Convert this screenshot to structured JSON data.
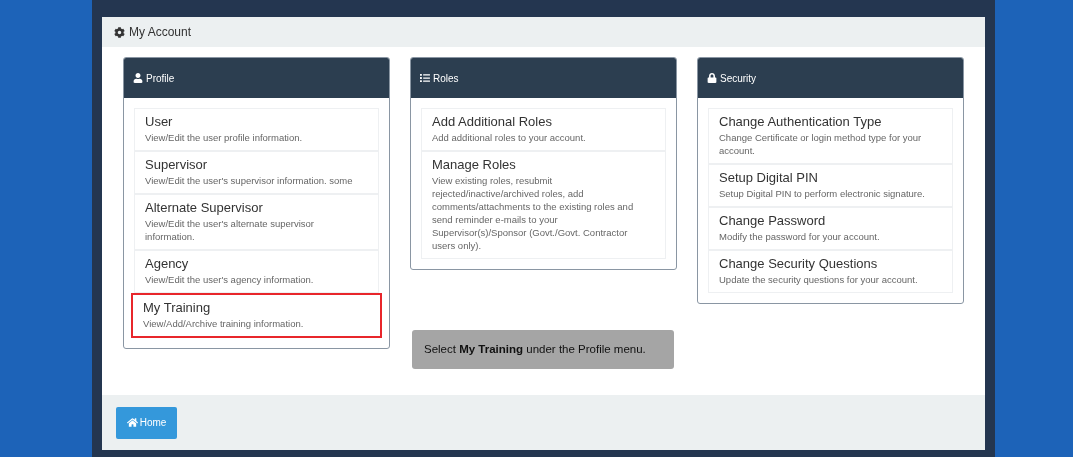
{
  "page_title": "My Account",
  "panels": [
    {
      "title": "Profile",
      "items": [
        {
          "title": "User",
          "description": "View/Edit the user profile information.",
          "highlighted": false
        },
        {
          "title": "Supervisor",
          "description": "View/Edit the user's supervisor information. some",
          "highlighted": false
        },
        {
          "title": "Alternate Supervisor",
          "description": "View/Edit the user's alternate supervisor information.",
          "highlighted": false
        },
        {
          "title": "Agency",
          "description": "View/Edit the user's agency information.",
          "highlighted": false
        },
        {
          "title": "My Training",
          "description": "View/Add/Archive training information.",
          "highlighted": true
        }
      ]
    },
    {
      "title": "Roles",
      "items": [
        {
          "title": "Add Additional Roles",
          "description": "Add additional roles to your account.",
          "highlighted": false
        },
        {
          "title": "Manage Roles",
          "description": "View existing roles, resubmit rejected/inactive/archived roles, add comments/attachments to the existing roles and send reminder e-mails to your Supervisor(s)/Sponsor (Govt./Govt. Contractor users only).",
          "highlighted": false
        }
      ]
    },
    {
      "title": "Security",
      "items": [
        {
          "title": "Change Authentication Type",
          "description": "Change Certificate or login method type for your account.",
          "highlighted": false
        },
        {
          "title": "Setup Digital PIN",
          "description": "Setup Digital PIN to perform electronic signature.",
          "highlighted": false
        },
        {
          "title": "Change Password",
          "description": "Modify the password for your account.",
          "highlighted": false
        },
        {
          "title": "Change Security Questions",
          "description": "Update the security questions for your account.",
          "highlighted": false
        }
      ]
    }
  ],
  "callout": "Select **My Training** under the Profile menu.",
  "home_button": "Home"
}
